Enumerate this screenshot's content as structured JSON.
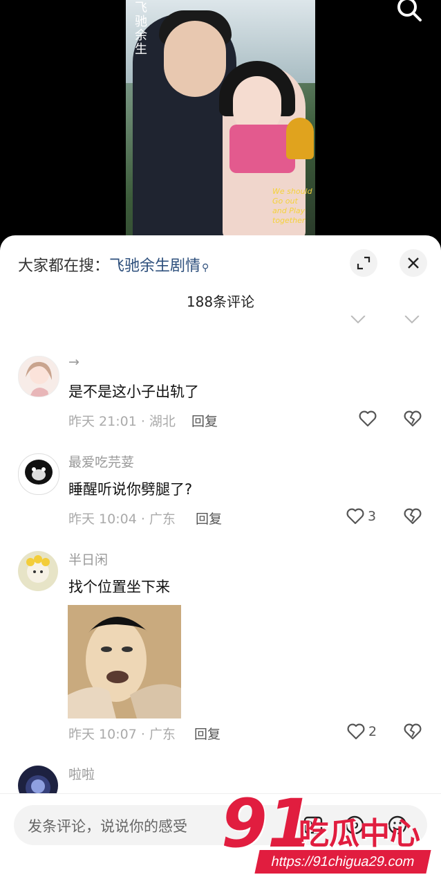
{
  "video": {
    "poster_title": "飞驰余生",
    "poster_tagline": "We should Go out and Play together"
  },
  "panel": {
    "hot_search_prefix": "大家都在搜：",
    "hot_search_keyword": "飞驰余生剧情",
    "comment_count": "188条评论",
    "cut_row": "",
    "cut_reply": ""
  },
  "comments": [
    {
      "username": "→",
      "text": "是不是这小子出轨了",
      "meta": "昨天 21:01 · 湖北",
      "reply": "回复",
      "likes": ""
    },
    {
      "username": "最爱吃芫荽",
      "text": "睡醒听说你劈腿了?",
      "meta": "昨天 10:04 · 广东",
      "reply": "回复",
      "likes": "3"
    },
    {
      "username": "半日闲",
      "text": "找个位置坐下来",
      "meta": "昨天 10:07 · 广东",
      "reply": "回复",
      "likes": "2"
    },
    {
      "username": "啦啦",
      "text": "",
      "meta": "",
      "reply": "",
      "likes": ""
    }
  ],
  "input": {
    "placeholder": "发条评论，说说你的感受"
  },
  "watermark": {
    "number": "91",
    "name": "吃瓜中心",
    "url": "https://91chigua29.com"
  },
  "colors": {
    "keyword": "#2d4f7c",
    "watermark": "#e11d3f"
  }
}
